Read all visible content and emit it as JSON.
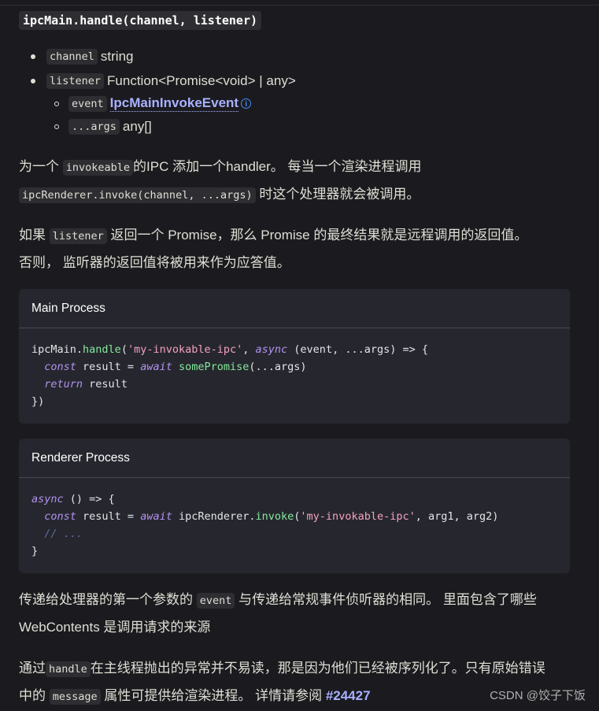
{
  "signature": "ipcMain.handle(channel, listener)",
  "params": [
    {
      "code": "channel",
      "type": "string"
    },
    {
      "code": "listener",
      "type": "Function<Promise<void> | any>"
    }
  ],
  "subparams": [
    {
      "code": "event",
      "type": "IpcMainInvokeEvent",
      "info_icon": "info-circle-icon"
    },
    {
      "code": "...args",
      "type": "any[]"
    }
  ],
  "para1": {
    "t1": "为一个 ",
    "c1": "invokeable",
    "t2": "的IPC 添加一个handler。 每当一个渲染进程调用",
    "c2": "ipcRenderer.invoke(channel, ...args)",
    "t3": " 时这个处理器就会被调用。"
  },
  "para2": {
    "t1": "如果 ",
    "c1": "listener",
    "t2": " 返回一个 Promise，那么 Promise 的最终结果就是远程调用的返回值。",
    "t3": "否则， 监听器的返回值将被用来作为应答值。"
  },
  "main_block": {
    "title": "Main Process",
    "lines": [
      [
        [
          "ipcMain.",
          "pl"
        ],
        [
          "handle",
          "green"
        ],
        [
          "(",
          "pl"
        ],
        [
          "'my-invokable-ipc'",
          "pink"
        ],
        [
          ", ",
          "pl"
        ],
        [
          "async",
          "purple-i"
        ],
        [
          " (event, ...args) => {",
          "pl"
        ]
      ],
      [
        [
          "  ",
          "pl"
        ],
        [
          "const",
          "purple-i"
        ],
        [
          " result = ",
          "pl"
        ],
        [
          "await",
          "purple-i"
        ],
        [
          " ",
          "pl"
        ],
        [
          "somePromise",
          "green"
        ],
        [
          "(...args)",
          "pl"
        ]
      ],
      [
        [
          "  ",
          "pl"
        ],
        [
          "return",
          "purple-i"
        ],
        [
          " result",
          "pl"
        ]
      ],
      [
        [
          "})",
          "pl"
        ]
      ]
    ]
  },
  "renderer_block": {
    "title": "Renderer Process",
    "lines": [
      [
        [
          "async",
          "purple-i"
        ],
        [
          " () => {",
          "pl"
        ]
      ],
      [
        [
          "  ",
          "pl"
        ],
        [
          "const",
          "purple-i"
        ],
        [
          " result = ",
          "pl"
        ],
        [
          "await",
          "purple-i"
        ],
        [
          " ipcRenderer.",
          "pl"
        ],
        [
          "invoke",
          "green"
        ],
        [
          "(",
          "pl"
        ],
        [
          "'my-invokable-ipc'",
          "pink"
        ],
        [
          ", arg1, arg2)",
          "pl"
        ]
      ],
      [
        [
          "  ",
          "pl"
        ],
        [
          "// ...",
          "comment"
        ]
      ],
      [
        [
          "}",
          "pl"
        ]
      ]
    ]
  },
  "para3": {
    "t1": "传递给处理器的第一个参数的 ",
    "c1": "event",
    "t2": " 与传递给常规事件侦听器的相同。 里面包含了哪些",
    "t3": "WebContents 是调用请求的来源"
  },
  "para4": {
    "t1": "通过",
    "c1": "handle",
    "t2": "在主线程抛出的异常并不易读，那是因为他们已经被序列化了。只有原始错误",
    "t3": "中的 ",
    "c2": "message",
    "t4": " 属性可提供给渲染进程。 详情请参阅 ",
    "issue": "#24427"
  },
  "watermark": "CSDN @饺子下饭"
}
